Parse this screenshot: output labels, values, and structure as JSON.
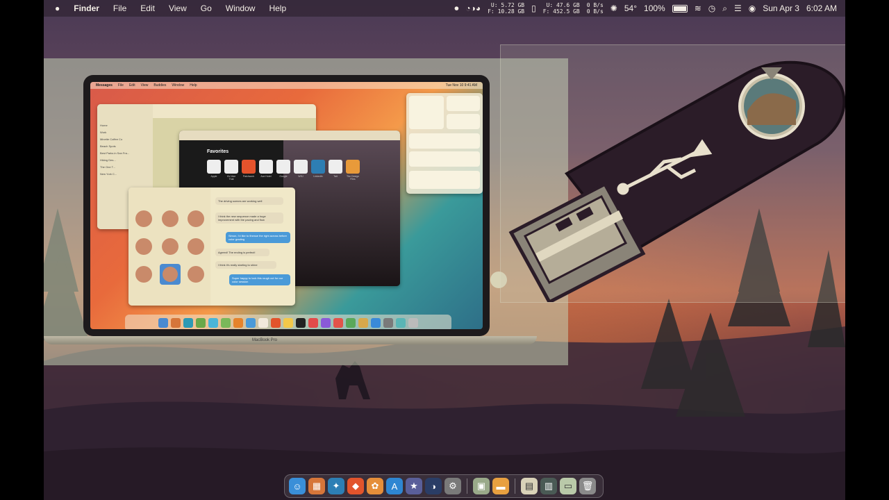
{
  "menubar": {
    "app_name": "Finder",
    "menus": [
      "File",
      "Edit",
      "View",
      "Go",
      "Window",
      "Help"
    ],
    "disk1_used": "5.72 GB",
    "disk1_free": "10.28 GB",
    "disk_u_label": "U:",
    "disk_f_label": "F:",
    "disk2_used": "47.6 GB",
    "disk2_free": "452.5 GB",
    "net_up": "0 B/s",
    "net_down": "0 B/s",
    "temperature": "54°",
    "battery": "100%",
    "date": "Sun Apr 3",
    "time": "6:02 AM"
  },
  "laptop": {
    "brand_label": "MacBook Pro",
    "menu_items": [
      "Messages",
      "File",
      "Edit",
      "View",
      "Buddies",
      "Window",
      "Help"
    ],
    "menu_time": "Tue Nov 10  9:41 AM",
    "favorites_title": "Favorites",
    "favorites": [
      "Apple",
      "It's Nice That",
      "Patchwork",
      "Ace Hotel",
      "Google",
      "WSJ",
      "LinkedIn",
      "Tait",
      "The Design Files"
    ],
    "messages": [
      "The driving scenes are working well",
      "I think the new sequence made a huge improvement with the pacing and flow",
      "Simon, I'd like to finesse the right across before color grading",
      "Agreed! The ending is perfect!",
      "I think it's really starting to shine",
      "Super happy to lock this rough cut for our color session"
    ],
    "sidebar": [
      "Home",
      "Work",
      "Minette Coffee Co",
      "Beach Spots",
      "Best Parks in San Fra...",
      "Hiking Des...",
      "The One T...",
      "New York C..."
    ]
  },
  "dock": {
    "items": [
      {
        "name": "finder",
        "icon": "☺",
        "color": "#3a8fd8"
      },
      {
        "name": "launchpad",
        "icon": "▦",
        "color": "#d6763a"
      },
      {
        "name": "safari",
        "icon": "✦",
        "color": "#2d7fb5"
      },
      {
        "name": "brave",
        "icon": "◆",
        "color": "#e2542c"
      },
      {
        "name": "photos",
        "icon": "✿",
        "color": "#e58e3a"
      },
      {
        "name": "app-store",
        "icon": "A",
        "color": "#2e86d2"
      },
      {
        "name": "reeder",
        "icon": "★",
        "color": "#5a5f9a"
      },
      {
        "name": "davinci-resolve",
        "icon": "◑",
        "color": "#2a3d66"
      },
      {
        "name": "system-preferences",
        "icon": "⚙",
        "color": "#7a7a7a"
      },
      {
        "name": "preview",
        "icon": "▣",
        "color": "#9aaa8a"
      },
      {
        "name": "folder",
        "icon": "▬",
        "color": "#e8a040"
      },
      {
        "name": "document",
        "icon": "▤",
        "color": "#d9d2b8"
      },
      {
        "name": "screenshot",
        "icon": "▥",
        "color": "#4a5a55"
      },
      {
        "name": "image-file",
        "icon": "▭",
        "color": "#b9c9a9"
      },
      {
        "name": "trash",
        "icon": "🗑",
        "color": "#8a8a8a"
      }
    ]
  },
  "colors": {
    "usb_body": "#2b1c28",
    "usb_connector": "#8a8478",
    "accent": "#e86a3c"
  }
}
